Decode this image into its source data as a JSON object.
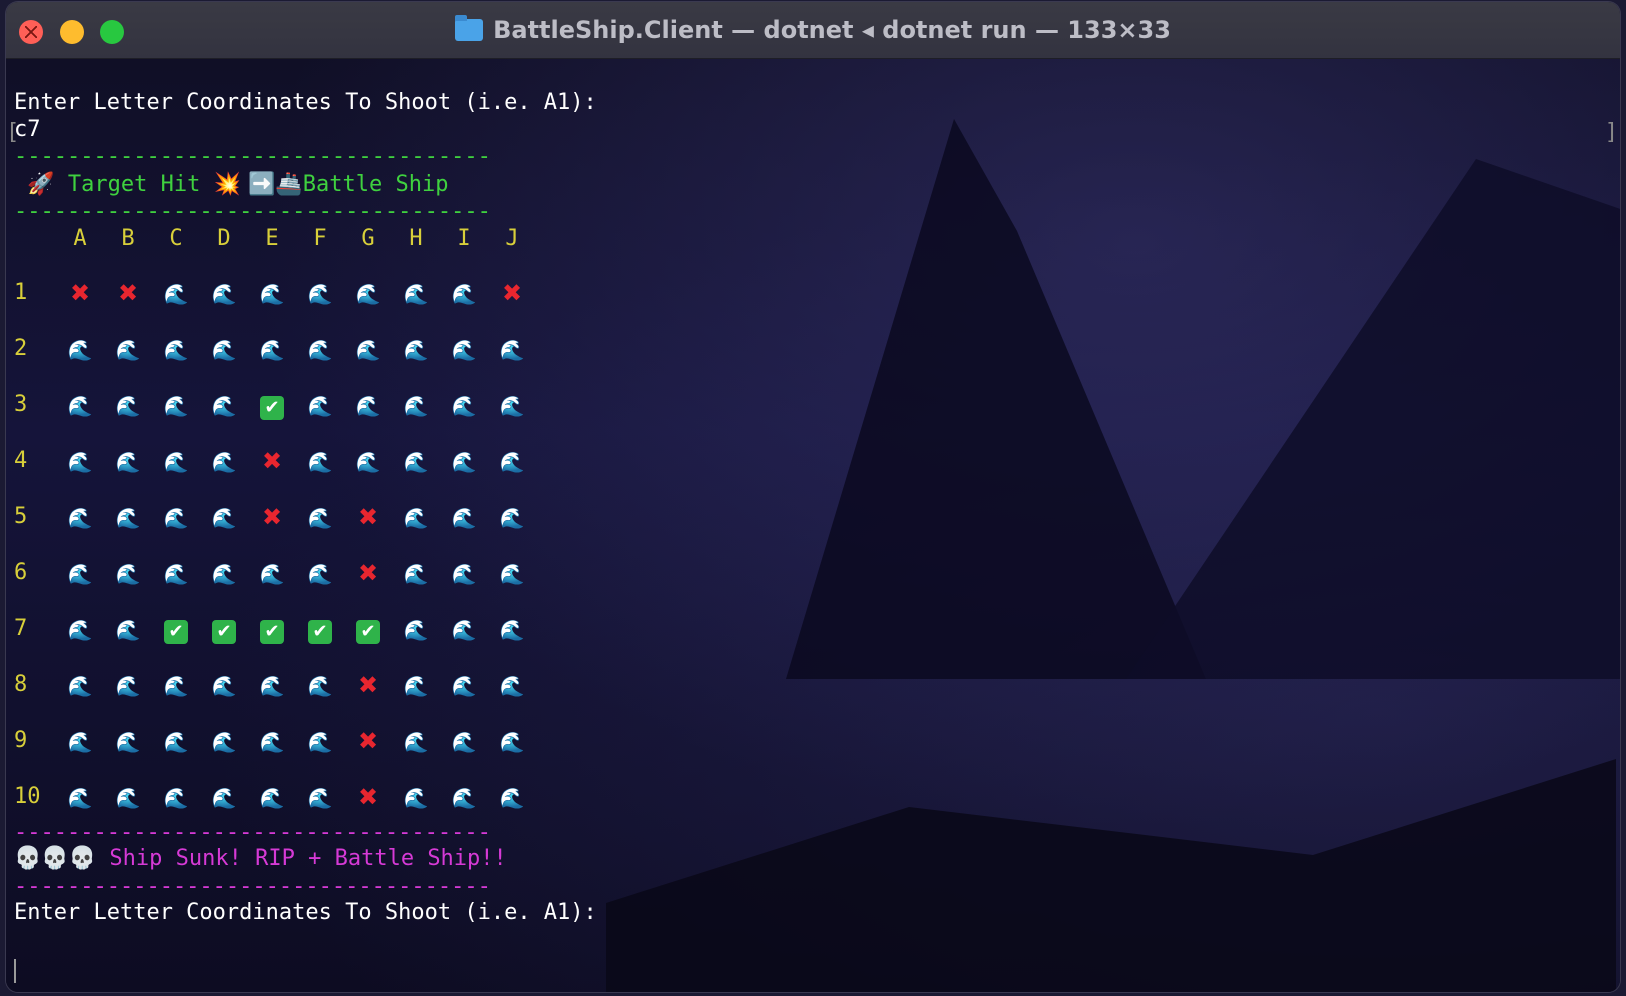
{
  "window": {
    "title": "BattleShip.Client — dotnet ◂ dotnet run — 133×33"
  },
  "terminal": {
    "prompt1": "Enter Letter Coordinates To Shoot (i.e. A1):",
    "input1": "c7",
    "divider": "------------------------------------",
    "hit_message": {
      "rocket": "🚀",
      "text1": " Target Hit ",
      "burst": "💥",
      "arrow": " ➡️🚢",
      "text2": "Battle Ship"
    },
    "sunk_message": {
      "skulls": "💀💀💀",
      "text": " Ship Sunk! RIP + Battle Ship!!"
    },
    "prompt2": "Enter Letter Coordinates To Shoot (i.e. A1):"
  },
  "grid": {
    "columns": [
      "A",
      "B",
      "C",
      "D",
      "E",
      "F",
      "G",
      "H",
      "I",
      "J"
    ],
    "rows": [
      {
        "label": "1",
        "cells": [
          "miss",
          "miss",
          "water",
          "water",
          "water",
          "water",
          "water",
          "water",
          "water",
          "miss"
        ]
      },
      {
        "label": "2",
        "cells": [
          "water",
          "water",
          "water",
          "water",
          "water",
          "water",
          "water",
          "water",
          "water",
          "water"
        ]
      },
      {
        "label": "3",
        "cells": [
          "water",
          "water",
          "water",
          "water",
          "hit",
          "water",
          "water",
          "water",
          "water",
          "water"
        ]
      },
      {
        "label": "4",
        "cells": [
          "water",
          "water",
          "water",
          "water",
          "miss",
          "water",
          "water",
          "water",
          "water",
          "water"
        ]
      },
      {
        "label": "5",
        "cells": [
          "water",
          "water",
          "water",
          "water",
          "miss",
          "water",
          "miss",
          "water",
          "water",
          "water"
        ]
      },
      {
        "label": "6",
        "cells": [
          "water",
          "water",
          "water",
          "water",
          "water",
          "water",
          "miss",
          "water",
          "water",
          "water"
        ]
      },
      {
        "label": "7",
        "cells": [
          "water",
          "water",
          "hit",
          "hit",
          "hit",
          "hit",
          "hit",
          "water",
          "water",
          "water"
        ]
      },
      {
        "label": "8",
        "cells": [
          "water",
          "water",
          "water",
          "water",
          "water",
          "water",
          "miss",
          "water",
          "water",
          "water"
        ]
      },
      {
        "label": "9",
        "cells": [
          "water",
          "water",
          "water",
          "water",
          "water",
          "water",
          "miss",
          "water",
          "water",
          "water"
        ]
      },
      {
        "label": "10",
        "cells": [
          "water",
          "water",
          "water",
          "water",
          "water",
          "water",
          "miss",
          "water",
          "water",
          "water"
        ]
      }
    ],
    "symbols": {
      "water": "🌊",
      "miss": "✖",
      "hit": "✔"
    }
  },
  "colors": {
    "hit_text": "#3fd13f",
    "sunk_text": "#d63ad6",
    "grid_labels": "#d8cf3a",
    "miss": "#e8262f",
    "hit_check_bg": "#2fb34a"
  }
}
